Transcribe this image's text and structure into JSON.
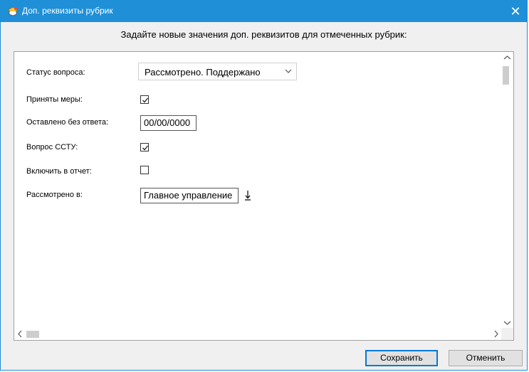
{
  "window": {
    "title": "Доп. реквизиты рубрик",
    "close_glyph": "✕",
    "accent_color": "#1f8fd8"
  },
  "instruction": "Задайте новые значения доп. реквизитов для отмеченных рубрик:",
  "fields": {
    "status": {
      "label": "Статус вопроса:",
      "value": "Рассмотрено. Поддержано"
    },
    "measures": {
      "label": "Приняты меры:",
      "checked": true
    },
    "unanswered": {
      "label": "Оставлено без ответа:",
      "value": "00/00/0000"
    },
    "sstu": {
      "label": "Вопрос ССТУ:",
      "checked": true
    },
    "report": {
      "label": "Включить в отчет:",
      "checked": false
    },
    "reviewed_in": {
      "label": "Рассмотрено в:",
      "value": "Главное управление"
    }
  },
  "icons": {
    "title": "app-icon",
    "dropdown": "chevron-down-icon",
    "pick": "download-arrow-icon"
  },
  "buttons": {
    "save": "Сохранить",
    "cancel": "Отменить"
  }
}
